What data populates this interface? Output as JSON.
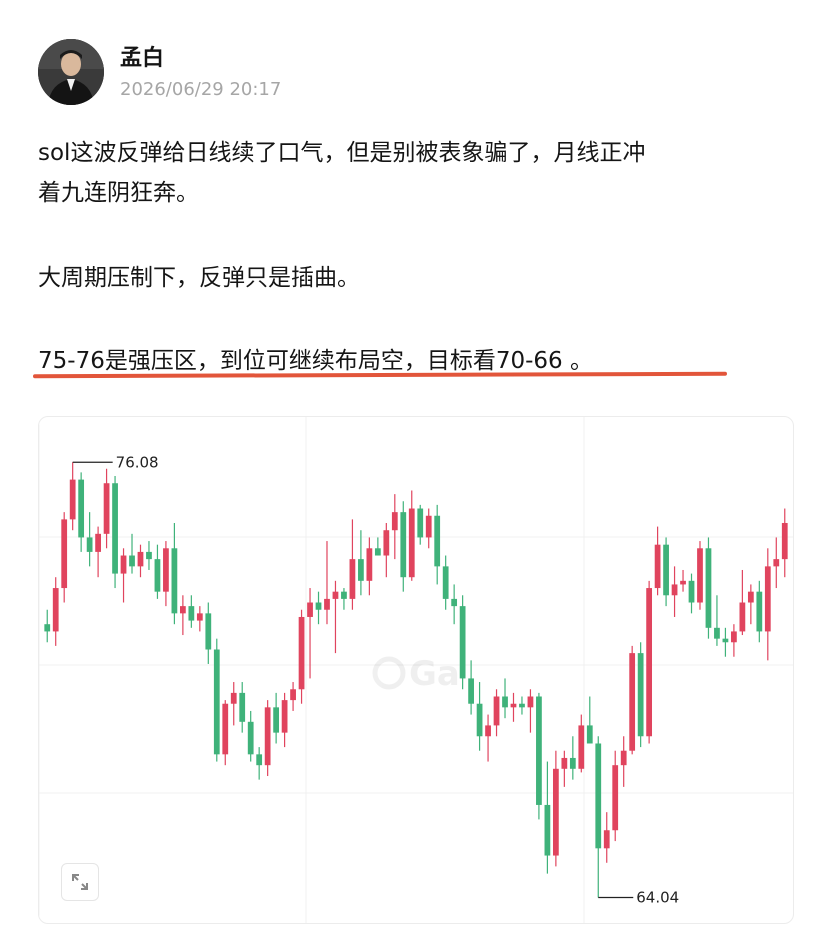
{
  "post": {
    "author": "孟白",
    "timestamp": "2026/06/29 20:17",
    "paragraphs": [
      "sol这波反弹给日线续了口气，但是别被表象骗了，月线正冲",
      "着九连阴狂奔。",
      "大周期压制下，反弹只是插曲。",
      "75-76是强压区，到位可继续布局空，目标看70-66 。"
    ]
  },
  "colors": {
    "up": "#e0445e",
    "down": "#3fb27a",
    "underline": "#e2553a"
  },
  "chart_data": {
    "type": "candlestick",
    "high_label": "76.08",
    "low_label": "64.04",
    "annotations": [
      "76.08",
      "64.04"
    ],
    "high_value": 76.08,
    "low_value": 64.04,
    "ylim": [
      63.5,
      77
    ],
    "grid": true,
    "candles": [
      {
        "o": 71.6,
        "h": 72.0,
        "l": 71.1,
        "c": 71.4
      },
      {
        "o": 71.4,
        "h": 72.9,
        "l": 71.0,
        "c": 72.6
      },
      {
        "o": 72.6,
        "h": 74.7,
        "l": 72.2,
        "c": 74.5
      },
      {
        "o": 74.5,
        "h": 76.08,
        "l": 74.2,
        "c": 75.6
      },
      {
        "o": 75.6,
        "h": 75.8,
        "l": 73.6,
        "c": 74.0
      },
      {
        "o": 74.0,
        "h": 74.7,
        "l": 73.2,
        "c": 73.6
      },
      {
        "o": 73.6,
        "h": 74.3,
        "l": 72.9,
        "c": 74.1
      },
      {
        "o": 74.1,
        "h": 75.9,
        "l": 73.7,
        "c": 75.5
      },
      {
        "o": 75.5,
        "h": 75.7,
        "l": 72.6,
        "c": 73.0
      },
      {
        "o": 73.0,
        "h": 73.7,
        "l": 72.2,
        "c": 73.5
      },
      {
        "o": 73.5,
        "h": 74.1,
        "l": 73.0,
        "c": 73.2
      },
      {
        "o": 73.2,
        "h": 73.8,
        "l": 72.9,
        "c": 73.6
      },
      {
        "o": 73.6,
        "h": 73.9,
        "l": 73.1,
        "c": 73.4
      },
      {
        "o": 73.4,
        "h": 73.8,
        "l": 72.3,
        "c": 72.5
      },
      {
        "o": 72.5,
        "h": 73.9,
        "l": 72.1,
        "c": 73.7
      },
      {
        "o": 73.7,
        "h": 74.4,
        "l": 71.6,
        "c": 71.9
      },
      {
        "o": 71.9,
        "h": 72.4,
        "l": 71.3,
        "c": 72.1
      },
      {
        "o": 72.1,
        "h": 72.4,
        "l": 71.5,
        "c": 71.7
      },
      {
        "o": 71.7,
        "h": 72.1,
        "l": 71.4,
        "c": 71.9
      },
      {
        "o": 71.9,
        "h": 72.2,
        "l": 70.5,
        "c": 70.9
      },
      {
        "o": 70.9,
        "h": 71.2,
        "l": 67.8,
        "c": 68.0
      },
      {
        "o": 68.0,
        "h": 69.5,
        "l": 67.7,
        "c": 69.4
      },
      {
        "o": 69.4,
        "h": 70.0,
        "l": 68.8,
        "c": 69.7
      },
      {
        "o": 69.7,
        "h": 70.0,
        "l": 68.6,
        "c": 68.9
      },
      {
        "o": 68.9,
        "h": 69.2,
        "l": 67.8,
        "c": 68.0
      },
      {
        "o": 68.0,
        "h": 68.2,
        "l": 67.3,
        "c": 67.7
      },
      {
        "o": 67.7,
        "h": 69.5,
        "l": 67.4,
        "c": 69.3
      },
      {
        "o": 69.3,
        "h": 69.7,
        "l": 68.3,
        "c": 68.6
      },
      {
        "o": 68.6,
        "h": 69.7,
        "l": 68.2,
        "c": 69.5
      },
      {
        "o": 69.5,
        "h": 70.0,
        "l": 69.2,
        "c": 69.8
      },
      {
        "o": 69.8,
        "h": 72.0,
        "l": 69.4,
        "c": 71.8
      },
      {
        "o": 71.8,
        "h": 72.6,
        "l": 70.1,
        "c": 72.2
      },
      {
        "o": 72.2,
        "h": 72.5,
        "l": 71.6,
        "c": 72.0
      },
      {
        "o": 72.0,
        "h": 73.9,
        "l": 71.6,
        "c": 72.3
      },
      {
        "o": 72.3,
        "h": 72.8,
        "l": 70.8,
        "c": 72.5
      },
      {
        "o": 72.5,
        "h": 72.6,
        "l": 72.0,
        "c": 72.3
      },
      {
        "o": 72.3,
        "h": 74.5,
        "l": 72.0,
        "c": 73.4
      },
      {
        "o": 73.4,
        "h": 74.2,
        "l": 72.4,
        "c": 72.8
      },
      {
        "o": 72.8,
        "h": 74.0,
        "l": 72.4,
        "c": 73.7
      },
      {
        "o": 73.7,
        "h": 74.0,
        "l": 73.5,
        "c": 73.5
      },
      {
        "o": 73.5,
        "h": 74.4,
        "l": 72.9,
        "c": 74.2
      },
      {
        "o": 74.2,
        "h": 75.2,
        "l": 73.4,
        "c": 74.7
      },
      {
        "o": 74.7,
        "h": 75.0,
        "l": 72.5,
        "c": 72.9
      },
      {
        "o": 72.9,
        "h": 75.3,
        "l": 72.8,
        "c": 74.8
      },
      {
        "o": 74.8,
        "h": 74.9,
        "l": 73.8,
        "c": 74.0
      },
      {
        "o": 74.0,
        "h": 74.8,
        "l": 73.7,
        "c": 74.6
      },
      {
        "o": 74.6,
        "h": 74.9,
        "l": 72.7,
        "c": 73.2
      },
      {
        "o": 73.2,
        "h": 73.5,
        "l": 72.0,
        "c": 72.3
      },
      {
        "o": 72.3,
        "h": 72.7,
        "l": 71.6,
        "c": 72.1
      },
      {
        "o": 72.1,
        "h": 72.4,
        "l": 69.8,
        "c": 70.1
      },
      {
        "o": 70.1,
        "h": 70.6,
        "l": 69.1,
        "c": 69.4
      },
      {
        "o": 69.4,
        "h": 70.0,
        "l": 68.1,
        "c": 68.5
      },
      {
        "o": 68.5,
        "h": 69.1,
        "l": 67.8,
        "c": 68.8
      },
      {
        "o": 68.8,
        "h": 69.8,
        "l": 68.5,
        "c": 69.6
      },
      {
        "o": 69.6,
        "h": 70.1,
        "l": 69.0,
        "c": 69.3
      },
      {
        "o": 69.3,
        "h": 69.7,
        "l": 68.9,
        "c": 69.4
      },
      {
        "o": 69.4,
        "h": 69.6,
        "l": 69.1,
        "c": 69.3
      },
      {
        "o": 69.3,
        "h": 69.8,
        "l": 68.6,
        "c": 69.6
      },
      {
        "o": 69.6,
        "h": 69.7,
        "l": 66.2,
        "c": 66.6
      },
      {
        "o": 66.6,
        "h": 67.8,
        "l": 64.7,
        "c": 65.2
      },
      {
        "o": 65.2,
        "h": 68.1,
        "l": 64.9,
        "c": 67.6
      },
      {
        "o": 67.6,
        "h": 68.1,
        "l": 67.1,
        "c": 67.9
      },
      {
        "o": 67.9,
        "h": 68.5,
        "l": 67.3,
        "c": 67.6
      },
      {
        "o": 67.6,
        "h": 69.1,
        "l": 67.5,
        "c": 68.8
      },
      {
        "o": 68.8,
        "h": 69.6,
        "l": 68.3,
        "c": 68.3
      },
      {
        "o": 68.3,
        "h": 68.5,
        "l": 64.04,
        "c": 65.4
      },
      {
        "o": 65.4,
        "h": 66.4,
        "l": 65.0,
        "c": 65.9
      },
      {
        "o": 65.9,
        "h": 68.1,
        "l": 65.6,
        "c": 67.7
      },
      {
        "o": 67.7,
        "h": 68.5,
        "l": 67.1,
        "c": 68.1
      },
      {
        "o": 68.1,
        "h": 71.0,
        "l": 68.0,
        "c": 70.8
      },
      {
        "o": 70.8,
        "h": 71.1,
        "l": 68.2,
        "c": 68.5
      },
      {
        "o": 68.5,
        "h": 72.8,
        "l": 68.3,
        "c": 72.6
      },
      {
        "o": 72.6,
        "h": 74.3,
        "l": 72.4,
        "c": 73.8
      },
      {
        "o": 73.8,
        "h": 74.0,
        "l": 72.1,
        "c": 72.4
      },
      {
        "o": 72.4,
        "h": 73.2,
        "l": 71.8,
        "c": 72.7
      },
      {
        "o": 72.7,
        "h": 73.1,
        "l": 72.5,
        "c": 72.8
      },
      {
        "o": 72.8,
        "h": 73.0,
        "l": 71.9,
        "c": 72.2
      },
      {
        "o": 72.2,
        "h": 73.9,
        "l": 72.0,
        "c": 73.7
      },
      {
        "o": 73.7,
        "h": 74.0,
        "l": 71.2,
        "c": 71.5
      },
      {
        "o": 71.5,
        "h": 72.4,
        "l": 71.0,
        "c": 71.2
      },
      {
        "o": 71.2,
        "h": 71.5,
        "l": 70.7,
        "c": 71.1
      },
      {
        "o": 71.1,
        "h": 71.6,
        "l": 70.7,
        "c": 71.4
      },
      {
        "o": 71.4,
        "h": 73.1,
        "l": 71.3,
        "c": 72.2
      },
      {
        "o": 72.2,
        "h": 72.7,
        "l": 71.6,
        "c": 72.5
      },
      {
        "o": 72.5,
        "h": 72.8,
        "l": 71.1,
        "c": 71.4
      },
      {
        "o": 71.4,
        "h": 73.7,
        "l": 70.6,
        "c": 73.2
      },
      {
        "o": 73.2,
        "h": 74.0,
        "l": 72.6,
        "c": 73.4
      },
      {
        "o": 73.4,
        "h": 74.8,
        "l": 72.9,
        "c": 74.4
      }
    ]
  }
}
